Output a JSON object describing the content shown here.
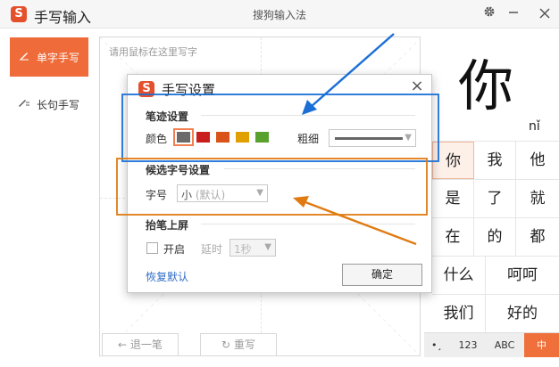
{
  "titlebar": {
    "app_title": "手写输入",
    "window_title": "搜狗输入法",
    "logo": "S",
    "gear_icon": "gear-icon",
    "minimize_icon": "minimize-icon",
    "close_icon": "close-icon"
  },
  "sidebar": {
    "items": [
      {
        "label": "单字手写",
        "icon": "single-char-icon",
        "active": true
      },
      {
        "label": "长句手写",
        "icon": "pen-icon",
        "active": false
      }
    ]
  },
  "pad": {
    "hint": "请用鼠标在这里写字",
    "undo_label": "退一笔",
    "rewrite_label": "重写"
  },
  "preview": {
    "char": "你",
    "pinyin": "nǐ"
  },
  "candidates": [
    [
      "你",
      "我",
      "他"
    ],
    [
      "是",
      "了",
      "就"
    ],
    [
      "在",
      "的",
      "都"
    ],
    [
      "什么",
      "呵呵"
    ],
    [
      "我们",
      "好的"
    ]
  ],
  "keyboard": {
    "symbol": "•︎¸",
    "num": "123",
    "abc": "ABC",
    "cn": "中"
  },
  "dialog": {
    "logo": "S",
    "title": "手写设置",
    "stroke_section": "笔迹设置",
    "color_label": "颜色",
    "colors": [
      "#6b6b6b",
      "#c81e1e",
      "#d9541a",
      "#e0a000",
      "#5aa02c"
    ],
    "thickness_label": "粗细",
    "candidate_section": "候选字号设置",
    "font_size_label": "字号",
    "font_size_value": "小",
    "font_size_hint": "(默认)",
    "pickup_section": "抬笔上屏",
    "enable_label": "开启",
    "delay_label": "延时",
    "delay_value": "1秒",
    "restore_label": "恢复默认",
    "ok_label": "确定"
  },
  "annotation_colors": {
    "blue": "#1a6fd6",
    "orange": "#e07b12"
  }
}
